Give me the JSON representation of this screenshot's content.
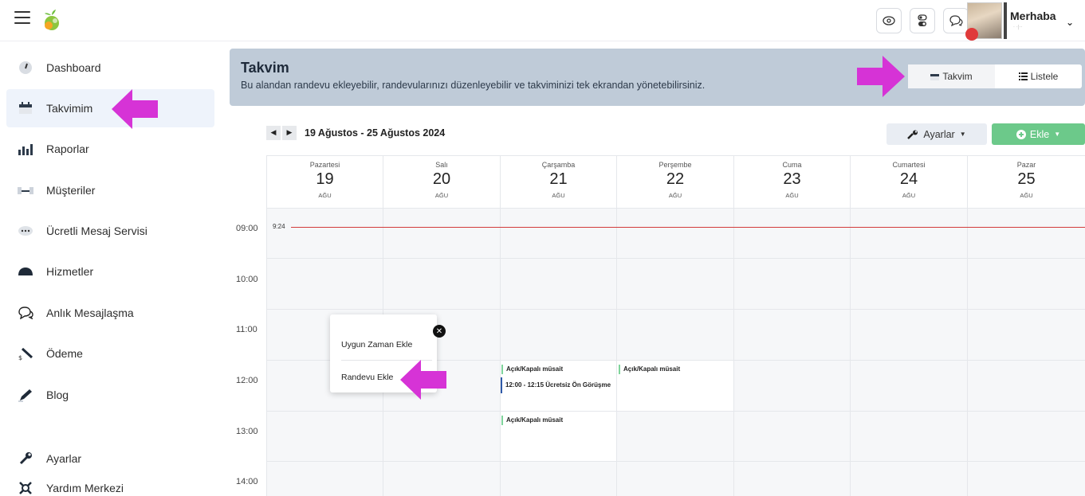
{
  "topbar": {
    "greeting": "Merhaba",
    "greeting_sub": "· ·|··",
    "icons": [
      "eye-icon",
      "toggle-icon",
      "chat-icon"
    ]
  },
  "sidebar": {
    "items": [
      {
        "label": "Dashboard",
        "icon": "gauge-icon"
      },
      {
        "label": "Takvimim",
        "icon": "calendar-icon"
      },
      {
        "label": "Raporlar",
        "icon": "bar-chart-icon"
      },
      {
        "label": "Müşteriler",
        "icon": "handshake-icon"
      },
      {
        "label": "Ücretli Mesaj Servisi",
        "icon": "sms-icon"
      },
      {
        "label": "Hizmetler",
        "icon": "dome-icon"
      },
      {
        "label": "Anlık Mesajlaşma",
        "icon": "chat-icon"
      },
      {
        "label": "Ödeme",
        "icon": "payment-icon"
      },
      {
        "label": "Blog",
        "icon": "pen-icon"
      },
      {
        "label": "Ayarlar",
        "icon": "wrench-icon"
      },
      {
        "label": "Yardım Merkezi",
        "icon": "help-icon"
      }
    ]
  },
  "header": {
    "title": "Takvim",
    "description": "Bu alandan randevu ekleyebilir, randevularınızı düzenleyebilir ve takviminizi tek ekrandan yönetebilirsiniz.",
    "view_calendar": "Takvim",
    "view_list": "Listele"
  },
  "calendar": {
    "range": "19 Ağustos - 25 Ağustos 2024",
    "settings_label": "Ayarlar",
    "add_label": "Ekle",
    "days": [
      {
        "name": "Pazartesi",
        "num": "19",
        "month": "AĞU"
      },
      {
        "name": "Salı",
        "num": "20",
        "month": "AĞU"
      },
      {
        "name": "Çarşamba",
        "num": "21",
        "month": "AĞU"
      },
      {
        "name": "Perşembe",
        "num": "22",
        "month": "AĞU"
      },
      {
        "name": "Cuma",
        "num": "23",
        "month": "AĞU"
      },
      {
        "name": "Cumartesi",
        "num": "24",
        "month": "AĞU"
      },
      {
        "name": "Pazar",
        "num": "25",
        "month": "AĞU"
      }
    ],
    "times": [
      "09:00",
      "10:00",
      "11:00",
      "12:00",
      "13:00",
      "14:00"
    ],
    "now_label": "9:24",
    "events": [
      {
        "label": "Açık/Kapalı müsait"
      },
      {
        "label": "12:00 - 12:15 Ücretsiz Ön Görüşme"
      },
      {
        "label": "Açık/Kapalı müsait"
      },
      {
        "label": "Açık/Kapalı müsait"
      }
    ]
  },
  "popup": {
    "item1": "Uygun Zaman Ekle",
    "item2": "Randevu Ekle"
  },
  "colors": {
    "header_bg": "#bfcbd8",
    "add_button": "#6cc98a",
    "now_line": "#d23b3b",
    "annotation_arrow": "#d633d6"
  }
}
